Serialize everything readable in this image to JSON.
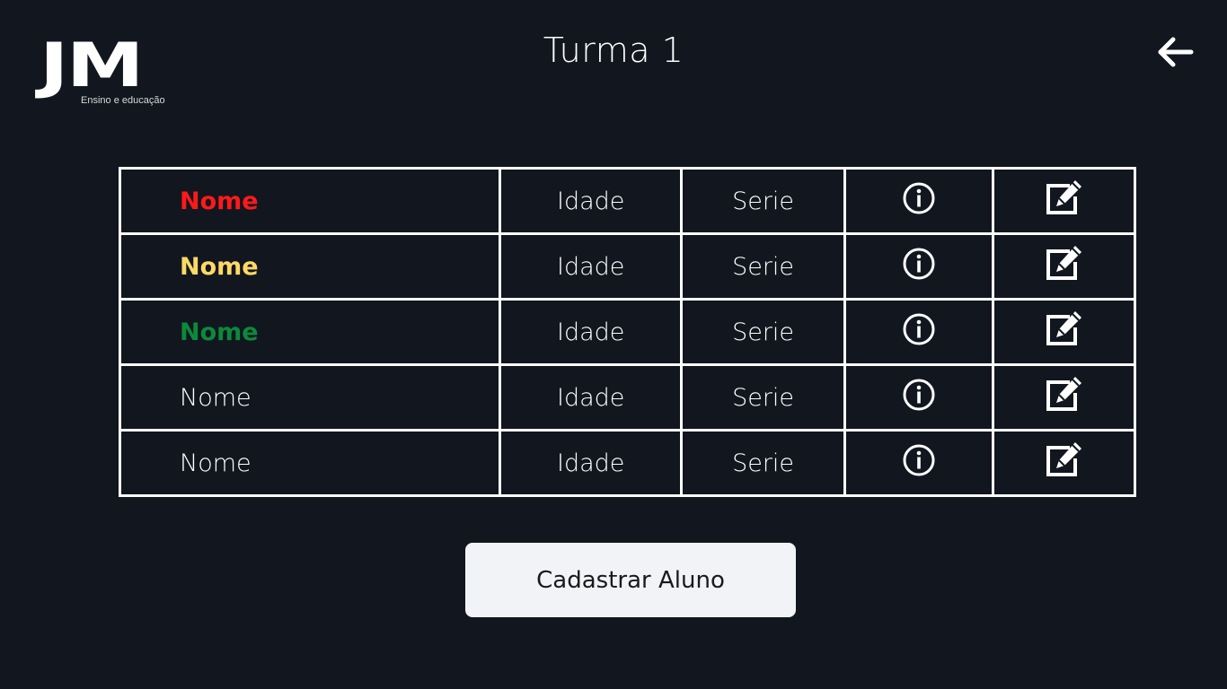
{
  "header": {
    "logo_text": "JM",
    "logo_tagline": "Ensino e educação",
    "title": "Turma 1",
    "back_icon": "arrow-left-icon"
  },
  "table": {
    "rows": [
      {
        "name": "Nome",
        "name_color": "#ff1a1a",
        "name_bold": true,
        "age": "Idade",
        "grade": "Serie",
        "info_icon": "info-circle-icon",
        "edit_icon": "edit-square-icon"
      },
      {
        "name": "Nome",
        "name_color": "#ffd966",
        "name_bold": true,
        "age": "Idade",
        "grade": "Serie",
        "info_icon": "info-circle-icon",
        "edit_icon": "edit-square-icon"
      },
      {
        "name": "Nome",
        "name_color": "#0b8a3a",
        "name_bold": true,
        "age": "Idade",
        "grade": "Serie",
        "info_icon": "info-circle-icon",
        "edit_icon": "edit-square-icon"
      },
      {
        "name": "Nome",
        "name_color": "#ffffff",
        "name_bold": false,
        "age": "Idade",
        "grade": "Serie",
        "info_icon": "info-circle-icon",
        "edit_icon": "edit-square-icon"
      },
      {
        "name": "Nome",
        "name_color": "#ffffff",
        "name_bold": false,
        "age": "Idade",
        "grade": "Serie",
        "info_icon": "info-circle-icon",
        "edit_icon": "edit-square-icon"
      }
    ]
  },
  "actions": {
    "register_label": "Cadastrar Aluno"
  },
  "colors": {
    "background": "#12161f",
    "button_background": "#f2f3f7"
  }
}
